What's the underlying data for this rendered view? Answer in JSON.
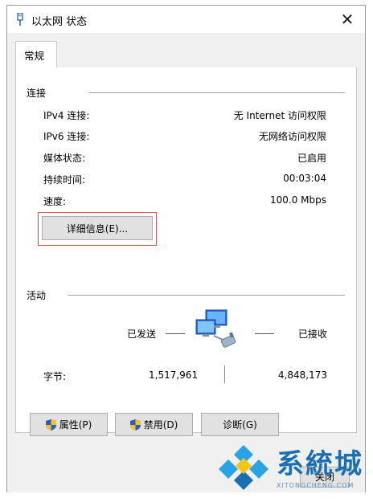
{
  "window": {
    "title": "以太网 状态",
    "close": "✕"
  },
  "tabs": [
    {
      "label": "常规"
    }
  ],
  "connection": {
    "title": "连接",
    "rows": [
      {
        "label": "IPv4 连接:",
        "value": "无 Internet 访问权限"
      },
      {
        "label": "IPv6 连接:",
        "value": "无网络访问权限"
      },
      {
        "label": "媒体状态:",
        "value": "已启用"
      },
      {
        "label": "持续时间:",
        "value": "00:03:04"
      },
      {
        "label": "速度:",
        "value": "100.0 Mbps"
      }
    ],
    "details_button": "详细信息(E)..."
  },
  "activity": {
    "title": "活动",
    "sent_label": "已发送",
    "received_label": "已接收",
    "bytes_label": "字节:",
    "bytes_sent": "1,517,961",
    "bytes_received": "4,848,173"
  },
  "buttons": {
    "properties": "属性(P)",
    "disable": "禁用(D)",
    "diagnose": "诊断(G)",
    "close": "关闭"
  },
  "watermark": {
    "text": "系統城",
    "url": "XITONGCHENG.COM"
  },
  "colors": {
    "accent_blue": "#1a6fb3",
    "focus_red": "#e05050",
    "panel_bg": "#f0f0f0"
  },
  "icons": [
    "ethernet-icon",
    "close-icon",
    "network-computers-icon",
    "shield-icon",
    "watermark-logo-icon"
  ]
}
